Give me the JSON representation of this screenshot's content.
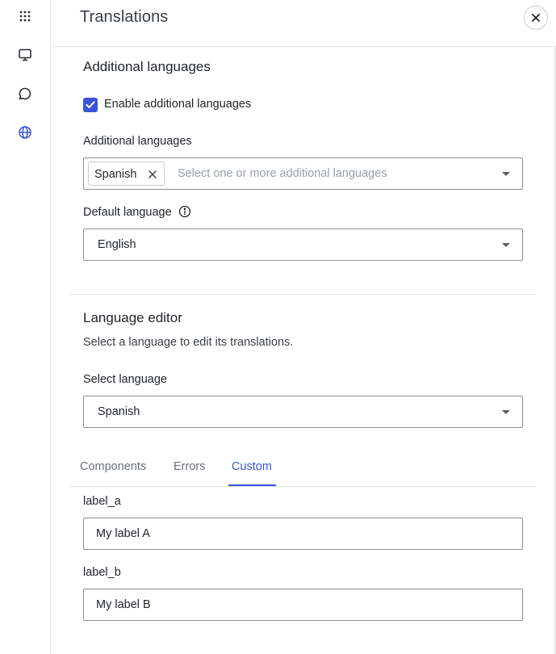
{
  "rail": {
    "items": [
      {
        "icon": "apps-grid-icon"
      },
      {
        "icon": "monitor-icon"
      },
      {
        "icon": "chat-bubble-icon"
      },
      {
        "icon": "globe-icon",
        "active": true
      }
    ]
  },
  "header": {
    "title": "Translations",
    "close_icon": "close-icon"
  },
  "additional_languages": {
    "section_title": "Additional languages",
    "enable_checkbox_label": "Enable additional languages",
    "enable_checked": true,
    "field_label": "Additional languages",
    "selected_tags": [
      "Spanish"
    ],
    "placeholder": "Select one or more additional languages",
    "default_language_label": "Default language",
    "default_language_value": "English"
  },
  "language_editor": {
    "section_title": "Language editor",
    "description": "Select a language to edit its translations.",
    "select_label": "Select language",
    "select_value": "Spanish"
  },
  "tabs": [
    {
      "label": "Components",
      "active": false
    },
    {
      "label": "Errors",
      "active": false
    },
    {
      "label": "Custom",
      "active": true
    }
  ],
  "custom_fields": [
    {
      "key": "label_a",
      "value": "My label A"
    },
    {
      "key": "label_b",
      "value": "My label B"
    }
  ],
  "colors": {
    "accent": "#3b54d6",
    "border": "#8b9098",
    "divider": "#e4e6ea"
  }
}
